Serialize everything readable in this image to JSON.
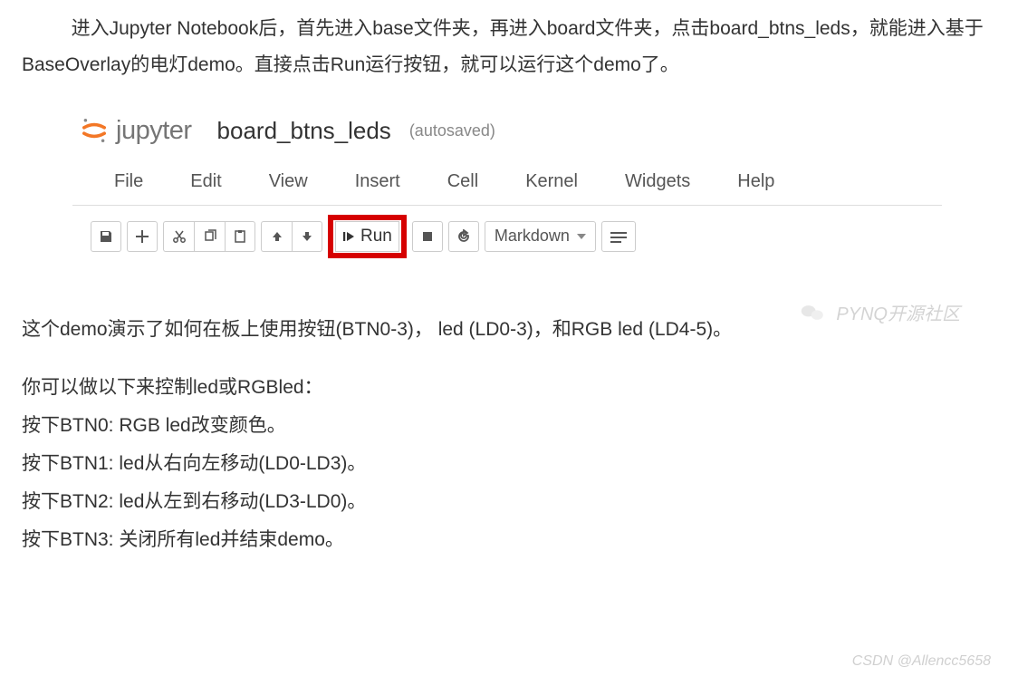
{
  "intro": {
    "line1": "进入Jupyter Notebook后，首先进入base文件夹，再进入board文件夹，点击board_btns_leds，就能进入基于BaseOverlay的电灯demo。直接点击Run运行按钮，就可以运行这个demo了。"
  },
  "jupyter": {
    "logo_text": "jupyter",
    "notebook_name": "board_btns_leds",
    "autosaved": "(autosaved)",
    "menu": {
      "file": "File",
      "edit": "Edit",
      "view": "View",
      "insert": "Insert",
      "cell": "Cell",
      "kernel": "Kernel",
      "widgets": "Widgets",
      "help": "Help"
    },
    "toolbar": {
      "run_label": "Run",
      "celltype": "Markdown"
    }
  },
  "watermark": "PYNQ开源社区",
  "description": {
    "p1": "这个demo演示了如何在板上使用按钮(BTN0-3)， led (LD0-3)，和RGB led (LD4-5)。",
    "p2": "你可以做以下来控制led或RGBled：",
    "b0": "按下BTN0: RGB led改变颜色。",
    "b1": "按下BTN1: led从右向左移动(LD0-LD3)。",
    "b2": "按下BTN2: led从左到右移动(LD3-LD0)。",
    "b3": "按下BTN3: 关闭所有led并结束demo。"
  },
  "csdn_watermark": "CSDN @Allencc5658"
}
